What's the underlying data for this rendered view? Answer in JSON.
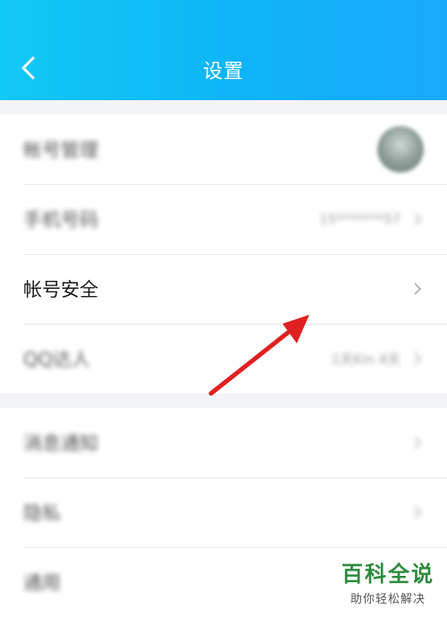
{
  "header": {
    "title": "设置",
    "back_icon": "chevron-left-icon"
  },
  "group1": [
    {
      "label": "帐号管理",
      "value": "",
      "blurred": true
    },
    {
      "label": "手机号码",
      "value": "15*******57",
      "blurred": true
    },
    {
      "label": "帐号安全",
      "value": "",
      "blurred": false
    },
    {
      "label": "QQ达人",
      "value": "1天Kin 4天",
      "blurred": true
    }
  ],
  "group2": [
    {
      "label": "消息通知",
      "blurred": true
    },
    {
      "label": "隐私",
      "blurred": true
    },
    {
      "label": "通用",
      "blurred": true
    }
  ],
  "annotation": {
    "arrow_color": "#e02020"
  },
  "watermark": {
    "title": "百科全说",
    "subtitle": "助你轻松解决"
  },
  "colors": {
    "header_start": "#12c8f5",
    "header_end": "#1aa9f8",
    "background": "#f2f3f7"
  }
}
